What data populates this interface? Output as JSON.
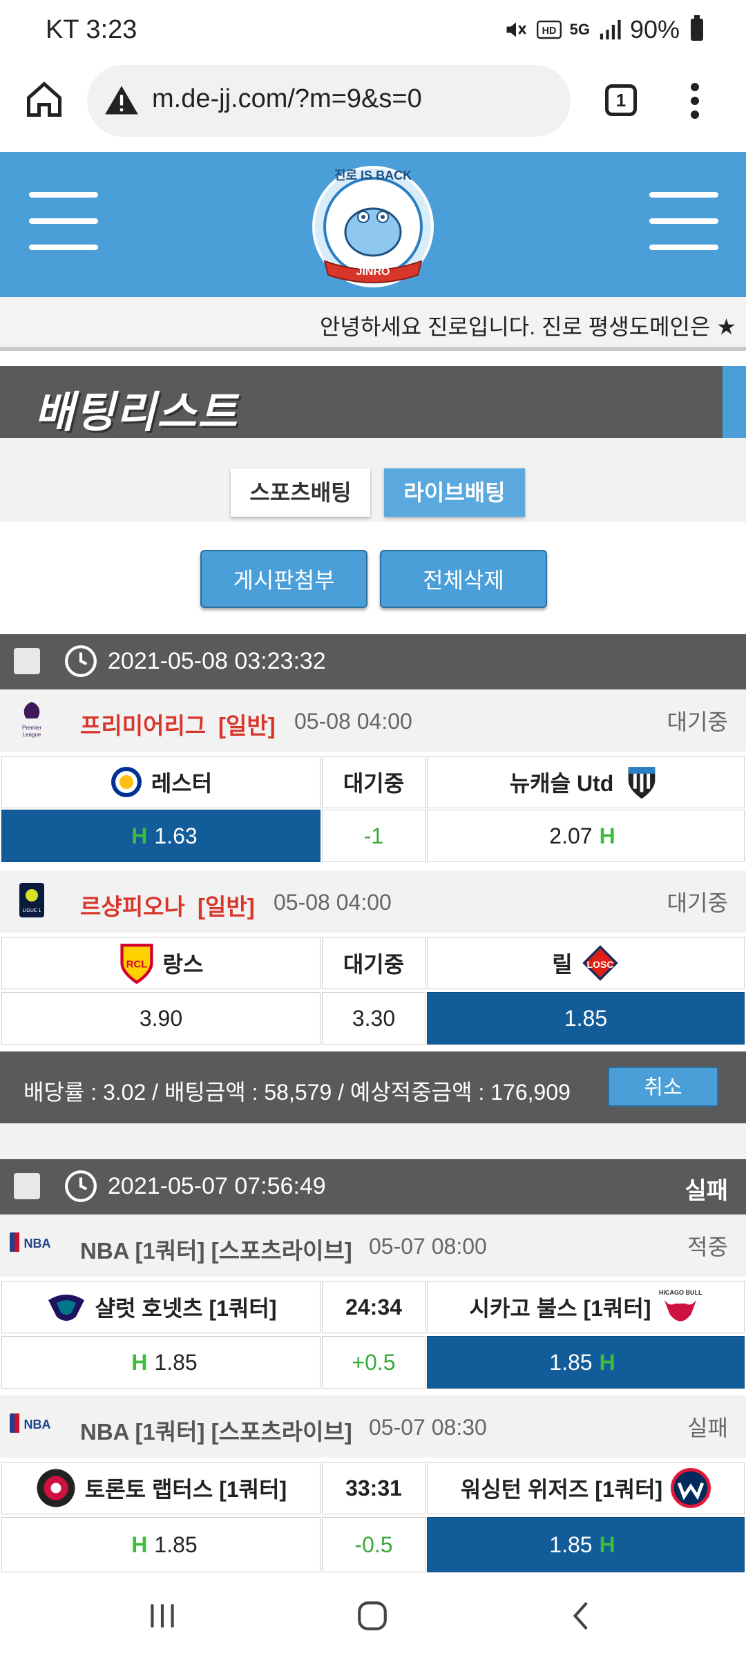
{
  "statusbar": {
    "carrier_time": "KT 3:23",
    "battery": "90%",
    "net": "5G"
  },
  "browser": {
    "url": "m.de-jj.com/?m=9&s=0",
    "tab_count": "1"
  },
  "header": {
    "logo_text": "JINRO",
    "logo_top": "진로 IS BACK"
  },
  "notice": {
    "text": "안녕하세요 진로입니다. 진로 평생도메인은 ★"
  },
  "section_title": "배팅리스트",
  "tabs": {
    "sports": "스포츠배팅",
    "live": "라이브배팅"
  },
  "actions": {
    "attach": "게시판첨부",
    "delete_all": "전체삭제"
  },
  "slips": [
    {
      "datetime": "2021-05-08 03:23:32",
      "result": "",
      "games": [
        {
          "league": "프리미어리그",
          "type": "[일반]",
          "time": "05-08 04:00",
          "status": "대기중",
          "home": "레스터",
          "mid_top": "대기중",
          "away": "뉴캐슬 Utd",
          "home_odds": "1.63",
          "mid_val": "-1",
          "away_odds": "2.07"
        },
        {
          "league": "르샹피오나",
          "type": "[일반]",
          "time": "05-08 04:00",
          "status": "대기중",
          "home": "랑스",
          "mid_top": "대기중",
          "away": "릴",
          "home_odds": "3.90",
          "mid_val": "3.30",
          "away_odds": "1.85"
        }
      ],
      "summary": "배당률 : 3.02 / 배팅금액 : 58,579 / 예상적중금액 : 176,909",
      "cancel": "취소"
    },
    {
      "datetime": "2021-05-07 07:56:49",
      "result": "실패",
      "games": [
        {
          "league": "NBA [1쿼터] [스포츠라이브]",
          "time": "05-07 08:00",
          "status": "적중",
          "home": "샬럿 호넷츠 [1쿼터]",
          "mid_top": "24:34",
          "away": "시카고 불스 [1쿼터]",
          "home_odds": "1.85",
          "mid_val": "+0.5",
          "away_odds": "1.85"
        },
        {
          "league": "NBA [1쿼터] [스포츠라이브]",
          "time": "05-07 08:30",
          "status": "실패",
          "home": "토론토 랩터스 [1쿼터]",
          "mid_top": "33:31",
          "away": "워싱턴 위저즈 [1쿼터]",
          "home_odds": "1.85",
          "mid_val": "-0.5",
          "away_odds": "1.85"
        }
      ]
    }
  ],
  "h_mark": "H",
  "colors": {
    "header_blue": "#4a9fd8",
    "selected": "#135c9a",
    "dark_bar": "#5a5a5a",
    "league_red": "#d9362b"
  }
}
